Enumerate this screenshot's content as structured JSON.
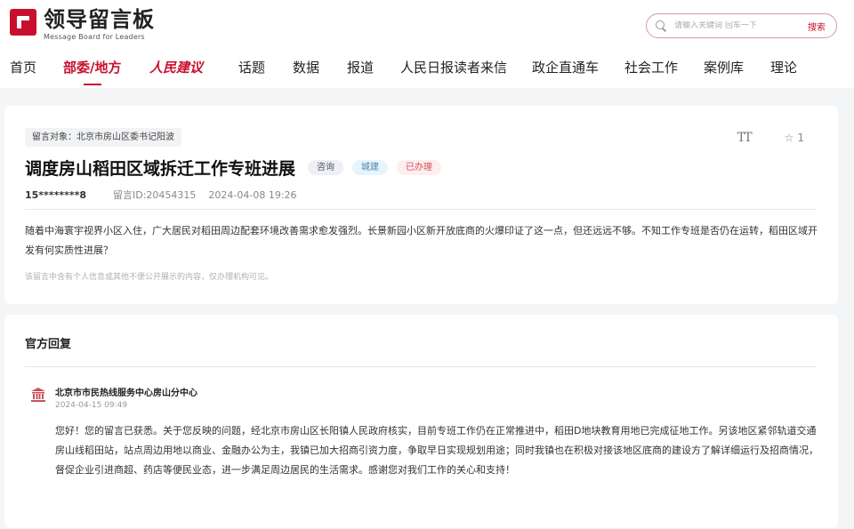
{
  "header": {
    "logo_title": "领导留言板",
    "logo_subtitle": "Message Board for Leaders",
    "search_placeholder": "请输入关键词 回车一下",
    "search_button": "搜索"
  },
  "nav": {
    "items": [
      {
        "label": "首页"
      },
      {
        "label": "部委/地方"
      },
      {
        "label": "人民建议"
      },
      {
        "label": "话题"
      },
      {
        "label": "数据"
      },
      {
        "label": "报道"
      },
      {
        "label": "人民日报读者来信"
      },
      {
        "label": "政企直通车"
      },
      {
        "label": "社会工作"
      },
      {
        "label": "案例库"
      },
      {
        "label": "理论"
      }
    ],
    "active": "部委/地方"
  },
  "message": {
    "target": "留言对象：北京市房山区委书记阳波",
    "title": "调度房山稻田区域拆迁工作专班进展",
    "tags": [
      "咨询",
      "城建",
      "已办理"
    ],
    "font_tool": "TT",
    "star_count": "1",
    "user": "15********8",
    "id_label": "留言ID:20454315",
    "time": "2024-04-08 19:26",
    "body": "随着中海寰宇视界小区入住，广大居民对稻田周边配套环境改善需求愈发强烈。长景新园小区新开放底商的火爆印证了这一点，但还远远不够。不知工作专班是否仍在运转，稻田区域开发有何实质性进展？",
    "privacy_note": "该留言中含有个人信息或其他不便公开展示的内容，仅办理机构可见。"
  },
  "reply": {
    "heading": "官方回复",
    "org": "北京市市民热线服务中心房山分中心",
    "time": "2024-04-15 09:49",
    "text": "您好！您的留言已获悉。关于您反映的问题，经北京市房山区长阳镇人民政府核实，目前专班工作仍在正常推进中，稻田D地块教育用地已完成征地工作。另该地区紧邻轨道交通房山线稻田站，站点周边用地以商业、金融办公为主，我镇已加大招商引资力度，争取早日实现规划用途；同时我镇也在积极对接该地区底商的建设方了解详细运行及招商情况，督促企业引进商超、药店等便民业态，进一步满足周边居民的生活需求。感谢您对我们工作的关心和支持！"
  },
  "colors": {
    "accent": "#c8102e"
  }
}
